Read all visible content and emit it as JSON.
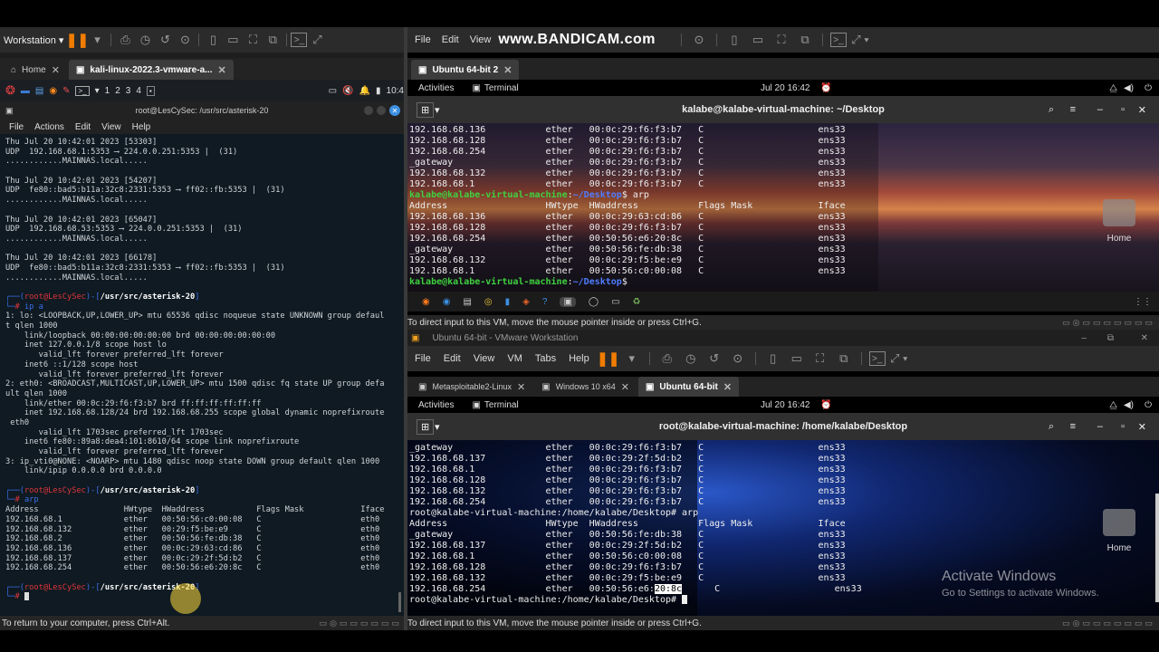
{
  "left_vm": {
    "menu_label": "Workstation",
    "tabs": [
      {
        "label": "Home"
      },
      {
        "label": "kali-linux-2022.3-vmware-a..."
      }
    ],
    "kali_bar": {
      "workspaces": [
        "1",
        "2",
        "3",
        "4"
      ],
      "clock": "10:4"
    },
    "terminal": {
      "title": "root@LesCySec: /usr/src/asterisk-20",
      "menu": [
        "File",
        "Actions",
        "Edit",
        "View",
        "Help"
      ],
      "lines": [
        "Thu Jul 20 10:42:01 2023 [53303]",
        "UDP  192.168.68.1:5353 ⟶ 224.0.0.251:5353 |  (31)",
        "............MAINNAS.local.....",
        "",
        "Thu Jul 20 10:42:01 2023 [54207]",
        "UDP  fe80::bad5:b11a:32c8:2331:5353 ⟶ ff02::fb:5353 |  (31)",
        "............MAINNAS.local.....",
        "",
        "Thu Jul 20 10:42:01 2023 [65047]",
        "UDP  192.168.68.53:5353 ⟶ 224.0.0.251:5353 |  (31)",
        "............MAINNAS.local.....",
        "",
        "Thu Jul 20 10:42:01 2023 [66178]",
        "UDP  fe80::bad5:b11a:32c8:2331:5353 ⟶ ff02::fb:5353 |  (31)",
        "............MAINNAS.local.....",
        ""
      ],
      "prompt_user": "root@LesCySec",
      "prompt_path": "/usr/src/asterisk-20",
      "cmd1": "ip a",
      "ip_lines": [
        "1: lo: <LOOPBACK,UP,LOWER_UP> mtu 65536 qdisc noqueue state UNKNOWN group defaul",
        "t qlen 1000",
        "    link/loopback 00:00:00:00:00:00 brd 00:00:00:00:00:00",
        "    inet 127.0.0.1/8 scope host lo",
        "       valid_lft forever preferred_lft forever",
        "    inet6 ::1/128 scope host",
        "       valid_lft forever preferred_lft forever",
        "2: eth0: <BROADCAST,MULTICAST,UP,LOWER_UP> mtu 1500 qdisc fq state UP group defa",
        "ult qlen 1000",
        "    link/ether 00:0c:29:f6:f3:b7 brd ff:ff:ff:ff:ff:ff",
        "    inet 192.168.68.128/24 brd 192.168.68.255 scope global dynamic noprefixroute",
        " eth0",
        "       valid_lft 1703sec preferred_lft 1703sec",
        "    inet6 fe80::89a8:dea4:101:8610/64 scope link noprefixroute",
        "       valid_lft forever preferred_lft forever",
        "3: ip_vti0@NONE: <NOARP> mtu 1480 qdisc noop state DOWN group default qlen 1000",
        "    link/ipip 0.0.0.0 brd 0.0.0.0",
        ""
      ],
      "cmd2": "arp",
      "arp_header": "Address                  HWtype  HWaddress           Flags Mask            Iface",
      "arp_rows": [
        "192.168.68.1             ether   00:50:56:c0:00:08   C                     eth0",
        "192.168.68.132           ether   00:29:f5:be:e9      C                     eth0",
        "192.168.68.2             ether   00:50:56:fe:db:38   C                     eth0",
        "192.168.68.136           ether   00:0c:29:63:cd:86   C                     eth0",
        "192.168.68.137           ether   00:0c:29:2f:5d:b2   C                     eth0",
        "192.168.68.254           ether   00:50:56:e6:20:8c   C                     eth0",
        ""
      ]
    },
    "status": "To return to your computer, press Ctrl+Alt."
  },
  "right_top": {
    "menu": [
      "File",
      "Edit",
      "View"
    ],
    "watermark": "www.BANDICAM.com",
    "tab": "Ubuntu 64-bit 2",
    "activities": "Activities",
    "app": "Terminal",
    "clock": "Jul 20  16:42",
    "title": "kalabe@kalabe-virtual-machine: ~/Desktop",
    "lines": [
      "192.168.68.136           ether   00:0c:29:f6:f3:b7   C                     ens33",
      "192.168.68.128           ether   00:0c:29:f6:f3:b7   C                     ens33",
      "192.168.68.254           ether   00:0c:29:f6:f3:b7   C                     ens33",
      "_gateway                 ether   00:0c:29:f6:f3:b7   C                     ens33",
      "192.168.68.132           ether   00:0c:29:f6:f3:b7   C                     ens33",
      "192.168.68.1             ether   00:0c:29:f6:f3:b7   C                     ens33"
    ],
    "prompt_user": "kalabe@kalabe-virtual-machine",
    "prompt_path": "~/Desktop",
    "cmd": "$ arp",
    "arp_header": "Address                  HWtype  HWaddress           Flags Mask            Iface",
    "arp_rows": [
      "192.168.68.136           ether   00:0c:29:63:cd:86   C                     ens33",
      "192.168.68.128           ether   00:0c:29:f6:f3:b7   C                     ens33",
      "192.168.68.254           ether   00:50:56:e6:20:8c   C                     ens33",
      "_gateway                 ether   00:50:56:fe:db:38   C                     ens33",
      "192.168.68.132           ether   00:0c:29:f5:be:e9   C                     ens33",
      "192.168.68.1             ether   00:50:56:c0:00:08   C                     ens33"
    ],
    "home_label": "Home",
    "status": "To direct input to this VM, move the mouse pointer inside or press Ctrl+G."
  },
  "right_bottom": {
    "window_title": "Ubuntu 64-bit - VMware Workstation",
    "menu": [
      "File",
      "Edit",
      "View",
      "VM",
      "Tabs",
      "Help"
    ],
    "tabs": [
      {
        "label": "Metasploitable2-Linux"
      },
      {
        "label": "Windows 10 x64"
      },
      {
        "label": "Ubuntu 64-bit"
      }
    ],
    "activities": "Activities",
    "app": "Terminal",
    "clock": "Jul 20  16:42",
    "title": "root@kalabe-virtual-machine: /home/kalabe/Desktop",
    "lines": [
      "_gateway                 ether   00:0c:29:f6:f3:b7   C                     ens33",
      "192.168.68.137           ether   00:0c:29:2f:5d:b2   C                     ens33",
      "192.168.68.1             ether   00:0c:29:f6:f3:b7   C                     ens33",
      "192.168.68.128           ether   00:0c:29:f6:f3:b7   C                     ens33",
      "192.168.68.132           ether   00:0c:29:f6:f3:b7   C                     ens33",
      "192.168.68.254           ether   00:0c:29:f6:f3:b7   C                     ens33",
      "root@kalabe-virtual-machine:/home/kalabe/Desktop# arp",
      "Address                  HWtype  HWaddress           Flags Mask            Iface",
      "_gateway                 ether   00:50:56:fe:db:38   C                     ens33",
      "192.168.68.137           ether   00:0c:29:2f:5d:b2   C                     ens33",
      "192.168.68.1             ether   00:50:56:c0:00:08   C                     ens33",
      "192.168.68.128           ether   00:0c:29:f6:f3:b7   C                     ens33",
      "192.168.68.132           ether   00:0c:29:f5:be:e9   C                     ens33"
    ],
    "last_row_prefix": "192.168.68.254           ether   00:50:56:e6:",
    "last_row_selected": "20:8c",
    "last_row_suffix": "      C                     ens33",
    "final_prompt": "root@kalabe-virtual-machine:/home/kalabe/Desktop# ",
    "home_label": "Home",
    "activate_title": "Activate Windows",
    "activate_sub": "Go to Settings to activate Windows.",
    "status": "To direct input to this VM, move the mouse pointer inside or press Ctrl+G."
  }
}
